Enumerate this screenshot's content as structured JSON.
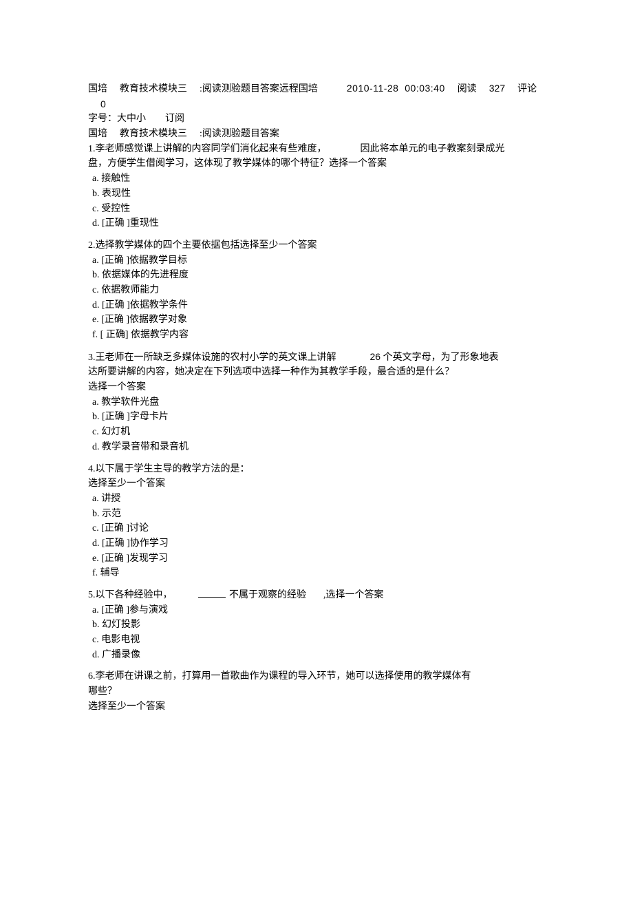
{
  "header": {
    "prefix": "国培",
    "module": "教育技术模块三",
    "subtitle": ":阅读测验题目答案远程国培",
    "timestamp": "2010-11-28  00:03:40",
    "read_label": "阅读",
    "read_count": "327",
    "comment_label": "评论",
    "comment_count": "0",
    "fontsize_label": "字号：大中小",
    "subscribe": "订阅",
    "subheading_prefix": "国培",
    "subheading_module": "教育技术模块三",
    "subheading_rest": ":阅读测验题目答案"
  },
  "q1": {
    "stem_a": "1.李老师感觉课上讲解的内容同学们消化起来有些难度，",
    "stem_b": "因此将本单元的电子教案刻录成光",
    "stem_c": "盘，方便学生借阅学习，这体现了教学媒体的哪个特征？选择一个答案",
    "a": "a.  接触性",
    "b": "b.  表现性",
    "c": "c.  受控性",
    "d": "d. [正确 ]重现性"
  },
  "q2": {
    "stem": "2.选择教学媒体的四个主要依据包括选择至少一个答案",
    "a": "a. [正确 ]依据教学目标",
    "b": "b.  依据媒体的先进程度",
    "c": "c.  依据教师能力",
    "d": "d. [正确 ]依据教学条件",
    "e": "e. [正确 ]依据教学对象",
    "f": "f. [ 正确] 依据教学内容"
  },
  "q3": {
    "stem_a": "3.王老师在一所缺乏多媒体设施的农村小学的英文课上讲解",
    "stem_num": "26",
    "stem_b": "个英文字母，为了形象地表",
    "stem_c": "达所要讲解的内容，她决定在下列选项中选择一种作为其教学手段，最合适的是什么？",
    "stem_d": "选择一个答案",
    "a": "a.  教学软件光盘",
    "b": "b. [正确 ]字母卡片",
    "c": "c.  幻灯机",
    "d": "d.  教学录音带和录音机"
  },
  "q4": {
    "stem_a": "4.以下属于学生主导的教学方法的是：",
    "stem_b": "选择至少一个答案",
    "a": "a.  讲授",
    "b": "b.  示范",
    "c": "c. [正确 ]讨论",
    "d": "d. [正确 ]协作学习",
    "e": "e. [正确 ]发现学习",
    "f": "f.  辅导"
  },
  "q5": {
    "stem_a": "5.以下各种经验中，",
    "stem_b": "不属于观察的经验",
    "stem_c": ",选择一个答案",
    "a": "a. [正确 ]参与演戏",
    "b": "b.  幻灯投影",
    "c": "c.  电影电视",
    "d": "d.  广播录像"
  },
  "q6": {
    "stem_a": "6.李老师在讲课之前，打算用一首歌曲作为课程的导入环节，她可以选择使用的教学媒体有",
    "stem_b": "哪些？",
    "stem_c": "选择至少一个答案"
  }
}
